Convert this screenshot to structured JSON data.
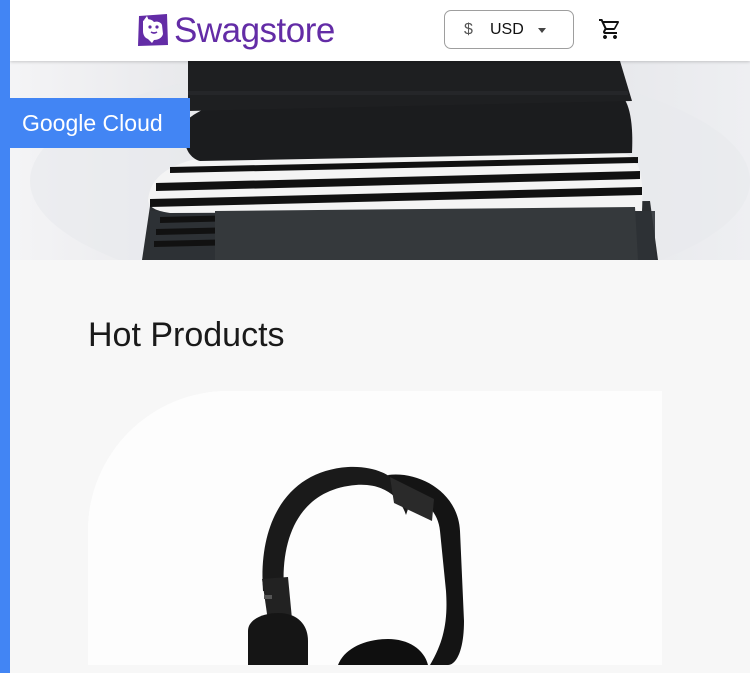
{
  "header": {
    "brand_name": "Swagstore",
    "brand_color": "#632ca6",
    "logo_icon": "dog-logo-icon",
    "currency": {
      "symbol": "$",
      "selected": "USD"
    },
    "cart_icon": "shopping-cart-icon"
  },
  "banner": {
    "badge_label": "Google Cloud",
    "badge_color": "#4285f4",
    "image": "folded-striped-shirts"
  },
  "main": {
    "section_title": "Hot Products",
    "products": [
      {
        "image": "black-headphones"
      }
    ]
  }
}
